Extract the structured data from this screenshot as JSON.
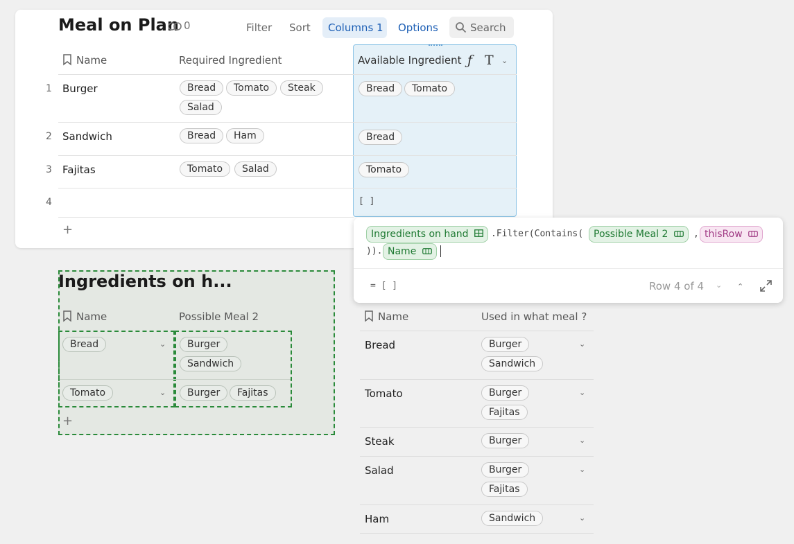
{
  "meal_table": {
    "title": "Meal on Plan",
    "link_count": "0",
    "toolbar": {
      "filter": "Filter",
      "sort": "Sort",
      "columns": "Columns",
      "columns_count": "1",
      "options": "Options",
      "search": "Search"
    },
    "columns": [
      "Name",
      "Required Ingredient",
      "Available Ingredient"
    ],
    "rows": [
      {
        "num": "1",
        "name": "Burger",
        "required": [
          "Bread",
          "Tomato",
          "Steak",
          "Salad"
        ],
        "available": [
          "Bread",
          "Tomato"
        ]
      },
      {
        "num": "2",
        "name": "Sandwich",
        "required": [
          "Bread",
          "Ham"
        ],
        "available": [
          "Bread"
        ]
      },
      {
        "num": "3",
        "name": "Fajitas",
        "required": [
          "Tomato",
          "Salad"
        ],
        "available": [
          "Tomato"
        ]
      },
      {
        "num": "4",
        "name": "",
        "required": [],
        "available_text": "[ ]"
      }
    ],
    "add_row": "+"
  },
  "formula_editor": {
    "tokens": {
      "table_ref": "Ingredients on hand",
      "text1": ".Filter(Contains(",
      "column_ref": "Possible Meal 2",
      "comma": ",",
      "this_row": "thisRow",
      "text2": ")).",
      "name_ref": "Name"
    },
    "result": "= [ ]",
    "row_indicator": "Row 4 of 4"
  },
  "ingredients_table": {
    "title": "Ingredients on h...",
    "columns": [
      "Name",
      "Possible Meal 2"
    ],
    "rows": [
      {
        "name": "Bread",
        "meals": [
          "Burger",
          "Sandwich"
        ]
      },
      {
        "name": "Tomato",
        "meals": [
          "Burger",
          "Fajitas"
        ]
      }
    ],
    "add_row": "+"
  },
  "lookup_table": {
    "columns": [
      "Name",
      "Used in what meal ?"
    ],
    "rows": [
      {
        "name": "Bread",
        "meals": [
          "Burger",
          "Sandwich"
        ]
      },
      {
        "name": "Tomato",
        "meals": [
          "Burger",
          "Fajitas"
        ]
      },
      {
        "name": "Steak",
        "meals": [
          "Burger"
        ]
      },
      {
        "name": "Salad",
        "meals": [
          "Burger",
          "Fajitas"
        ]
      },
      {
        "name": "Ham",
        "meals": [
          "Sandwich"
        ]
      }
    ]
  },
  "colors": {
    "accent_blue": "#1d5fb5",
    "selected_column": "#e5f1f8",
    "selection_green": "#1f7a33"
  },
  "icons": [
    "link-icon",
    "search-icon",
    "bookmark-icon",
    "formula-icon",
    "text-type-icon",
    "chevron-down-icon",
    "table-icon",
    "column-icon",
    "expand-icon",
    "chevron-up-icon"
  ]
}
